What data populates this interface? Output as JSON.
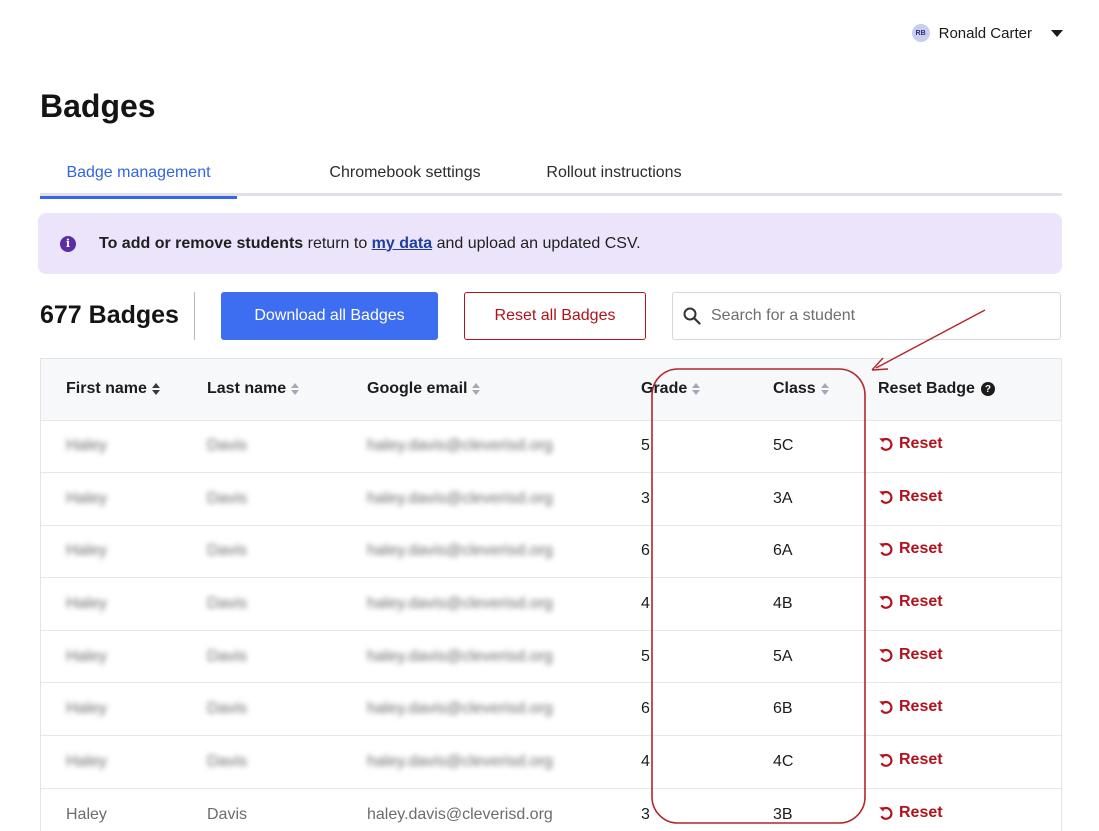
{
  "user": {
    "initials": "RB",
    "name": "Ronald Carter"
  },
  "page": {
    "title": "Badges"
  },
  "tabs": [
    {
      "label": "Badge management",
      "active": true
    },
    {
      "label": "Chromebook settings",
      "active": false
    },
    {
      "label": "Rollout instructions",
      "active": false
    }
  ],
  "banner": {
    "bold": "To add or remove students",
    "text1": " return to ",
    "link": "my data",
    "text2": " and upload an updated CSV."
  },
  "toolbar": {
    "count": "677 Badges",
    "download_label": "Download all Badges",
    "reset_all_label": "Reset all Badges",
    "search_placeholder": "Search for a student"
  },
  "table": {
    "headers": [
      "First name",
      "Last name",
      "Google email",
      "Grade",
      "Class",
      "Reset Badge"
    ],
    "reset_label": "Reset",
    "rows": [
      {
        "first": "Haley",
        "last": "Davis",
        "email": "haley.davis@cleverisd.org",
        "grade": "5",
        "class": "5C"
      },
      {
        "first": "Haley",
        "last": "Davis",
        "email": "haley.davis@cleverisd.org",
        "grade": "3",
        "class": "3A"
      },
      {
        "first": "Haley",
        "last": "Davis",
        "email": "haley.davis@cleverisd.org",
        "grade": "6",
        "class": "6A"
      },
      {
        "first": "Haley",
        "last": "Davis",
        "email": "haley.davis@cleverisd.org",
        "grade": "4",
        "class": "4B"
      },
      {
        "first": "Haley",
        "last": "Davis",
        "email": "haley.davis@cleverisd.org",
        "grade": "5",
        "class": "5A"
      },
      {
        "first": "Haley",
        "last": "Davis",
        "email": "haley.davis@cleverisd.org",
        "grade": "6",
        "class": "6B"
      },
      {
        "first": "Haley",
        "last": "Davis",
        "email": "haley.davis@cleverisd.org",
        "grade": "4",
        "class": "4C"
      },
      {
        "first": "Haley",
        "last": "Davis",
        "email": "haley.davis@cleverisd.org",
        "grade": "3",
        "class": "3B"
      }
    ]
  },
  "colors": {
    "accent": "#3d6df0",
    "danger": "#b3121c",
    "banner_bg": "#ece4fb",
    "annotation": "#b3262d"
  },
  "icons": [
    "avatar",
    "caret-down-icon",
    "info-icon",
    "search-icon",
    "sort-icon",
    "help-icon",
    "undo-icon"
  ]
}
